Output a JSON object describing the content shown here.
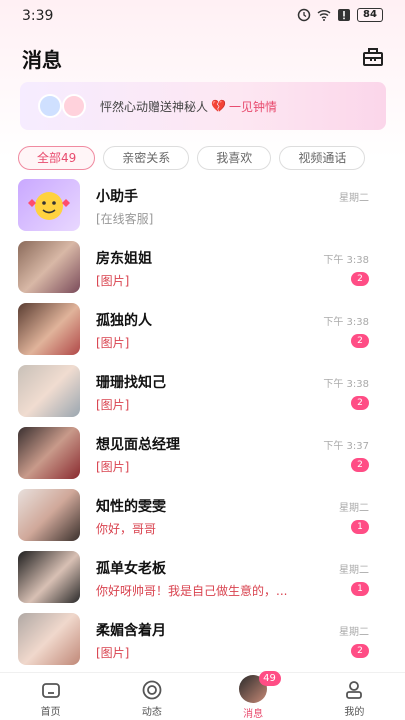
{
  "status_bar": {
    "time": "3:39",
    "battery": "84"
  },
  "header": {
    "title": "消息"
  },
  "banner": {
    "text": "怦然心动赠送神秘人",
    "highlight": "一见钟情"
  },
  "tabs": [
    {
      "label": "全部49",
      "active": true
    },
    {
      "label": "亲密关系",
      "active": false
    },
    {
      "label": "我喜欢",
      "active": false
    },
    {
      "label": "视频通话",
      "active": false
    }
  ],
  "conversations": [
    {
      "name": "小助手",
      "time": "星期二",
      "preview": "[在线客服]",
      "badge": ""
    },
    {
      "name": "房东姐姐",
      "time": "下午 3:38",
      "preview": "[图片]",
      "badge": "2"
    },
    {
      "name": "孤独的人",
      "time": "下午 3:38",
      "preview": "[图片]",
      "badge": "2"
    },
    {
      "name": "珊珊找知己",
      "time": "下午 3:38",
      "preview": "[图片]",
      "badge": "2"
    },
    {
      "name": "想见面总经理",
      "time": "下午 3:37",
      "preview": "[图片]",
      "badge": "2"
    },
    {
      "name": "知性的雯雯",
      "time": "星期二",
      "preview": "你好，哥哥",
      "badge": "1"
    },
    {
      "name": "孤单女老板",
      "time": "星期二",
      "preview": "你好呀帅哥！我是自己做生意的，...",
      "badge": "1"
    },
    {
      "name": "柔媚含着月",
      "time": "星期二",
      "preview": "[图片]",
      "badge": "2"
    }
  ],
  "bottom_nav": {
    "items": [
      {
        "label": "首页",
        "icon": "home-icon"
      },
      {
        "label": "动态",
        "icon": "moments-icon"
      },
      {
        "label": "消息",
        "icon": "messages-avatar",
        "badge": "49",
        "active": true
      },
      {
        "label": "我的",
        "icon": "profile-icon"
      }
    ]
  },
  "colors": {
    "accent": "#e84b6e",
    "badge": "#ff4d85"
  }
}
